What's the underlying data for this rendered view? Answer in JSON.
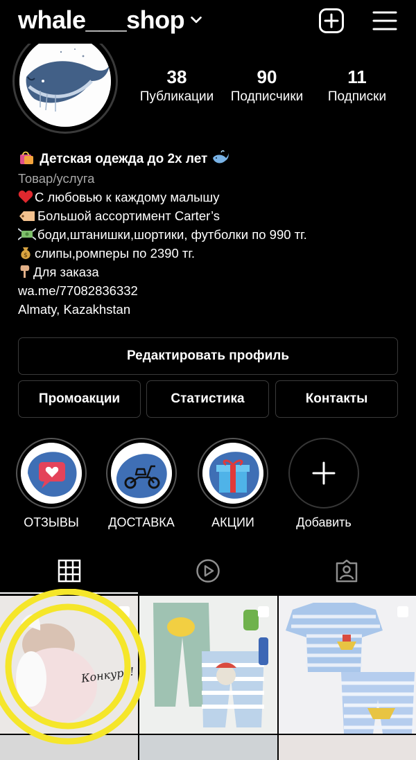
{
  "header": {
    "username": "whale___shop",
    "icons": {
      "new_post": "plus-square-icon",
      "menu": "hamburger-menu-icon",
      "switch": "chevron-down-icon"
    }
  },
  "stats": [
    {
      "num": "38",
      "label": "Публикации"
    },
    {
      "num": "90",
      "label": "Подписчики"
    },
    {
      "num": "11",
      "label": "Подписки"
    }
  ],
  "bio": {
    "name": "Детская одежда до 2х лет",
    "category": "Товар/услуга",
    "lines": [
      "С любовью к каждому малышу",
      "Большой ассортимент Carter’s",
      "боди,штанишки,шортики, футболки по 990 тг.",
      "слипы,ромперы по 2390 тг.",
      "Для заказа"
    ],
    "link": "wa.me/77082836332",
    "location": "Almaty, Kazakhstan"
  },
  "buttons": {
    "edit": "Редактировать профиль",
    "promo": "Промоакции",
    "stats": "Статистика",
    "contacts": "Контакты"
  },
  "highlights": [
    {
      "label": "ОТЗЫВЫ"
    },
    {
      "label": "ДОСТАВКА"
    },
    {
      "label": "АКЦИИ"
    },
    {
      "label": "Добавить"
    }
  ],
  "posts": [
    {
      "caption": "Конкурс!"
    }
  ],
  "colors": {
    "background": "#000000",
    "text": "#ffffff",
    "muted": "#a8a8a8",
    "border": "#3b3b3b",
    "highlight_ring": "#f5e62a",
    "accent_blue": "#3f6fb5"
  }
}
